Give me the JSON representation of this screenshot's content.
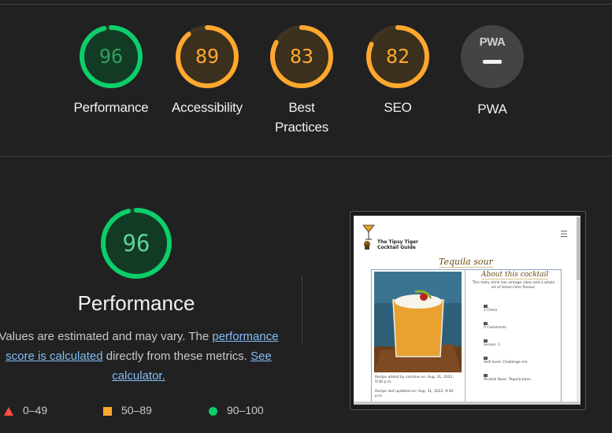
{
  "summary": {
    "gauges": [
      {
        "score": "96",
        "label": "Performance",
        "color": "#0cce6b",
        "fill": "#123a24",
        "textColor": "#2ea062",
        "fraction": 0.96
      },
      {
        "score": "89",
        "label": "Accessibility",
        "color": "#ffa82e",
        "fill": "#3b2f1d",
        "textColor": "#ffa82e",
        "fraction": 0.89
      },
      {
        "score": "83",
        "label_line1": "Best",
        "label_line2": "Practices",
        "color": "#ffa82e",
        "fill": "#3b2f1d",
        "textColor": "#ffa82e",
        "fraction": 0.83
      },
      {
        "score": "82",
        "label": "SEO",
        "color": "#ffa82e",
        "fill": "#3b2f1d",
        "textColor": "#ffa82e",
        "fraction": 0.82
      },
      {
        "score": "PWA",
        "label": "PWA",
        "icon": "pwa-dash-icon"
      }
    ]
  },
  "performance": {
    "score": "96",
    "fraction": 0.96,
    "title": "Performance",
    "desc_part1": "Values are estimated and may vary. The ",
    "link1": "performance score is calculated",
    "desc_part2": " directly from these metrics. ",
    "link2": "See calculator."
  },
  "legend": [
    {
      "shape": "triangle",
      "range": "0–49",
      "color": "#ff4e42"
    },
    {
      "shape": "square",
      "range": "50–89",
      "color": "#ffa82e"
    },
    {
      "shape": "circle",
      "range": "90–100",
      "color": "#0cce6b"
    }
  ],
  "screenshot": {
    "brand_name": "The Tipsy Tiger Cocktail Guide",
    "menu_icon": "hamburger-icon",
    "recipe_title": "Tequila sour",
    "about_title": "About this cocktail",
    "about_text": "This tasty drink has vintage vibes and a whole lot of lemon lime flavour.",
    "info": [
      {
        "icon": "glass-icon",
        "text": "1 Cheer"
      },
      {
        "icon": "comment-icon",
        "text": "0 Comments"
      },
      {
        "icon": "serves-icon",
        "text": "Serves: 1"
      },
      {
        "icon": "skill-icon",
        "text": "Skill level: Challenge me"
      },
      {
        "icon": "spirit-icon",
        "text": "Alcohol Base: Tequila base"
      }
    ],
    "added": "Recipe added by caroline on: Aug. 31, 2022, 9:30 p.m.",
    "updated": "Recipe last updated on: Aug. 31, 2022, 9:30 p.m."
  }
}
